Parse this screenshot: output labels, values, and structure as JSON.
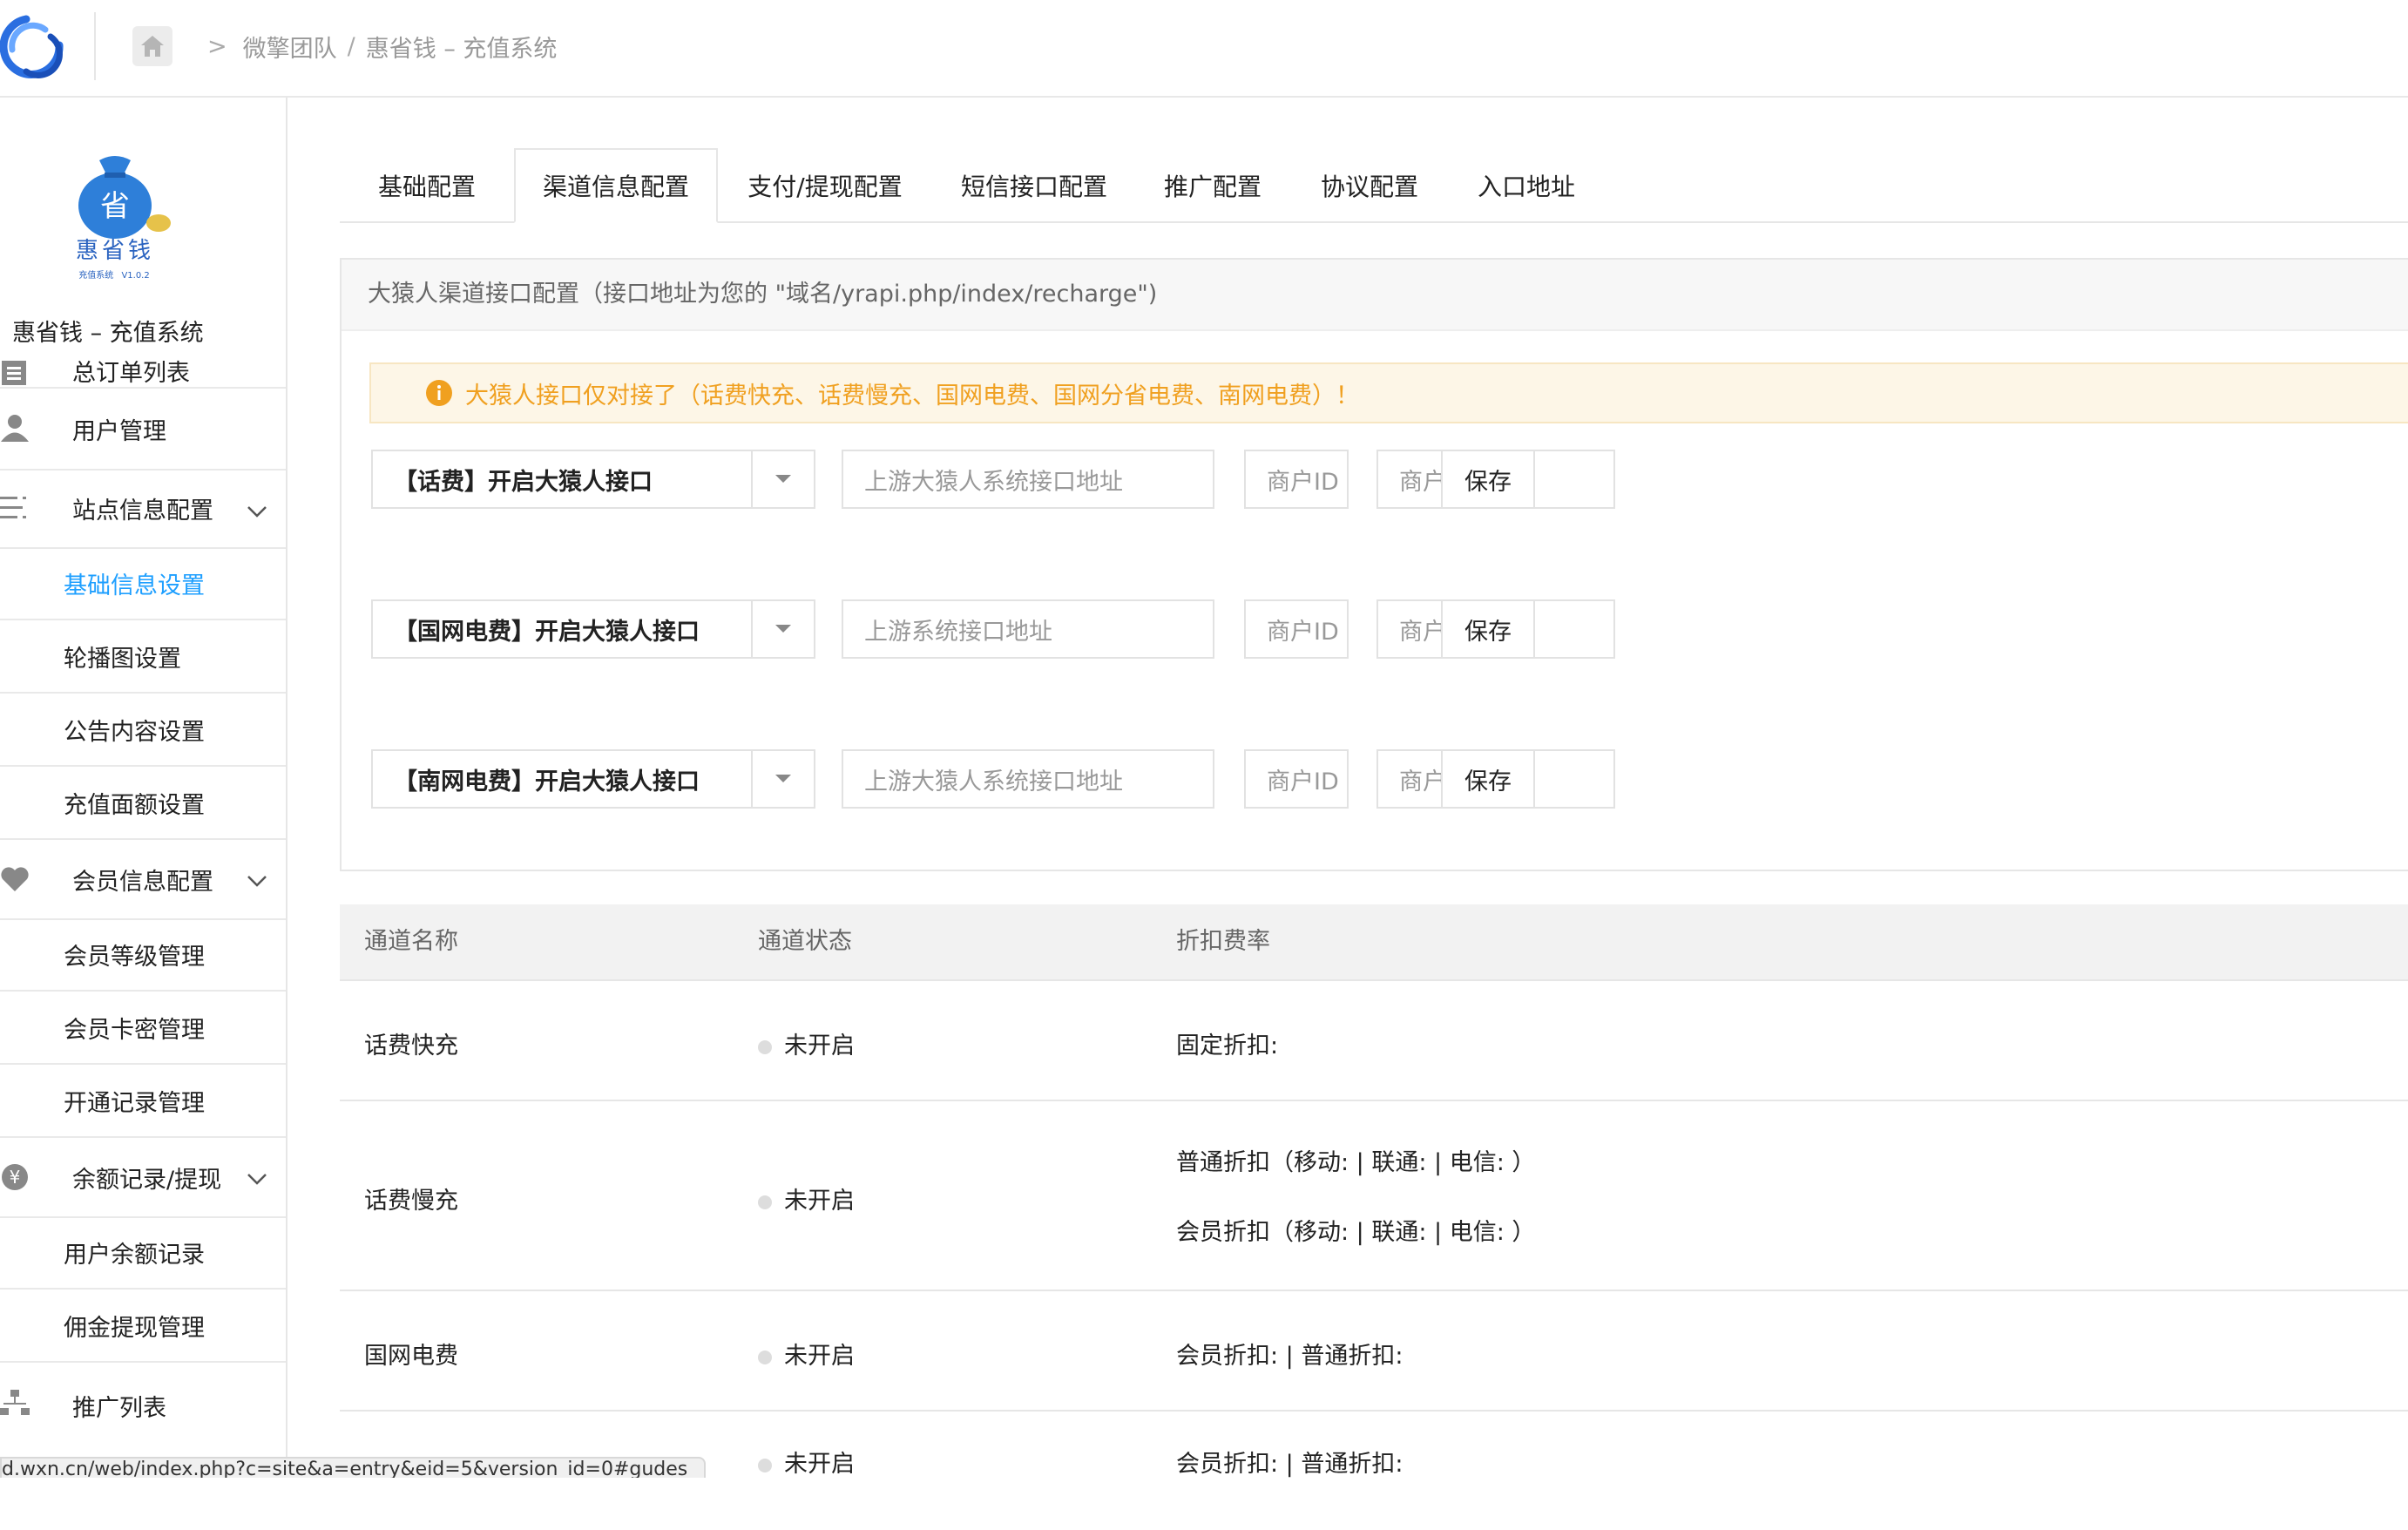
{
  "breadcrumb": {
    "items": [
      "微擎团队",
      "惠省钱 – 充值系统"
    ]
  },
  "sidebar": {
    "brand_name": "惠省钱",
    "brand_logo_char": "省",
    "brand_tagline": "充值系统",
    "brand_version": "V1.0.2",
    "title": "惠省钱 – 充值系统",
    "items": [
      {
        "label": "总订单列表",
        "icon": "list-icon"
      },
      {
        "label": "用户管理",
        "icon": "user-icon"
      },
      {
        "label": "站点信息配置",
        "icon": "menu-icon"
      },
      {
        "label": "基础信息设置"
      },
      {
        "label": "轮播图设置"
      },
      {
        "label": "公告内容设置"
      },
      {
        "label": "充值面额设置"
      },
      {
        "label": "会员信息配置",
        "icon": "heart-icon"
      },
      {
        "label": "会员等级管理"
      },
      {
        "label": "会员卡密管理"
      },
      {
        "label": "开通记录管理"
      },
      {
        "label": "余额记录/提现",
        "icon": "yen-icon"
      },
      {
        "label": "用户余额记录"
      },
      {
        "label": "佣金提现管理"
      },
      {
        "label": "推广列表",
        "icon": "sitemap-icon"
      }
    ]
  },
  "tabs": [
    "基础配置",
    "渠道信息配置",
    "支付/提现配置",
    "短信接口配置",
    "推广配置",
    "协议配置",
    "入口地址"
  ],
  "panel": {
    "title": "大猿人渠道接口配置（接口地址为您的 \"域名/yrapi.php/index/recharge\")",
    "notice": "大猿人接口仅对接了（话费快充、话费慢充、国网电费、国网分省电费、南网电费）！",
    "rows": [
      {
        "select": "【话费】开启大猿人接口",
        "url_placeholder": "上游大猿人系统接口地址",
        "merchant_placeholder": "商户ID",
        "secret_placeholder": "商户秘钥",
        "save": "保存"
      },
      {
        "select": "【国网电费】开启大猿人接口",
        "url_placeholder": "上游系统接口地址",
        "merchant_placeholder": "商户ID",
        "secret_placeholder": "商户秘钥",
        "save": "保存"
      },
      {
        "select": "【南网电费】开启大猿人接口",
        "url_placeholder": "上游大猿人系统接口地址",
        "merchant_placeholder": "商户ID",
        "secret_placeholder": "商户秘钥",
        "save": "保存"
      }
    ]
  },
  "table": {
    "headers": [
      "通道名称",
      "通道状态",
      "折扣费率"
    ],
    "rows": [
      {
        "name": "话费快充",
        "status": "未开启",
        "rate": [
          "固定折扣:"
        ]
      },
      {
        "name": "话费慢充",
        "status": "未开启",
        "rate": [
          "普通折扣（移动: | 联通: | 电信: ）",
          "会员折扣（移动: | 联通: | 电信: ）"
        ]
      },
      {
        "name": "国网电费",
        "status": "未开启",
        "rate": [
          "会员折扣: | 普通折扣:"
        ]
      },
      {
        "name": "",
        "status": "未开启",
        "rate": [
          "会员折扣: | 普通折扣:"
        ]
      }
    ]
  },
  "statusbar": {
    "url": "d.wxn.cn/web/index.php?c=site&a=entry&eid=5&version_id=0#gudes"
  },
  "colors": {
    "accent": "#1e9fff",
    "warning": "#f0a020",
    "notice_bg": "#fdf6e7"
  }
}
